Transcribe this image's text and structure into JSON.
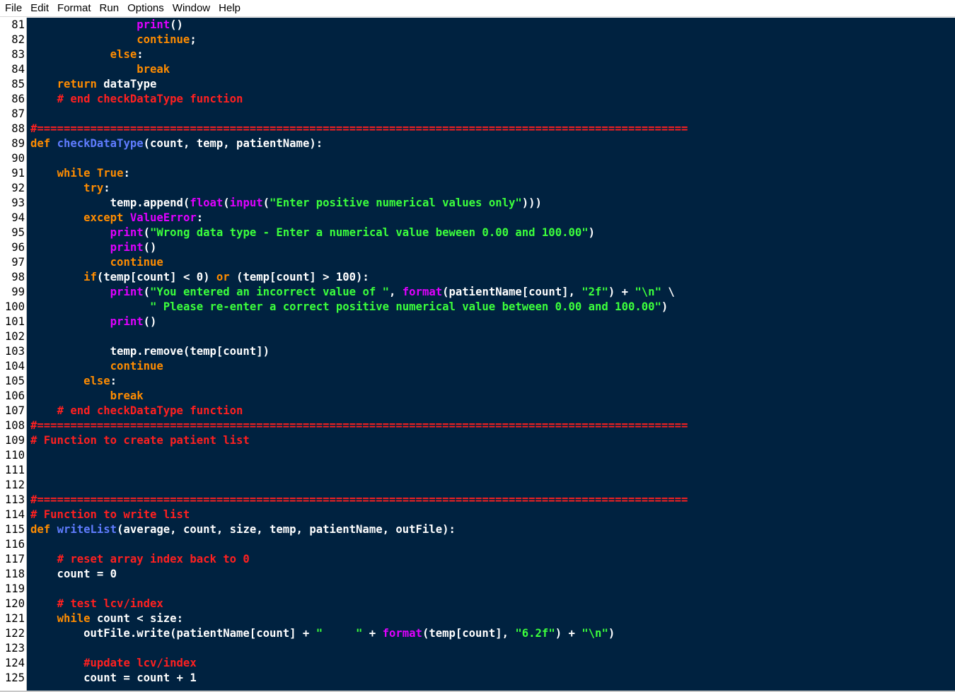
{
  "menu": [
    "File",
    "Edit",
    "Format",
    "Run",
    "Options",
    "Window",
    "Help"
  ],
  "colors": {
    "background": "#002240",
    "keyword": "#ff8c00",
    "definition": "#5f7cff",
    "builtin": "#e000ff",
    "string": "#3cff3c",
    "comment": "#ff2020",
    "default": "#ffffff"
  },
  "lines": [
    {
      "n": "81",
      "s": [
        [
          "",
          "                "
        ],
        [
          "bi",
          "print"
        ],
        [
          "",
          "()"
        ]
      ]
    },
    {
      "n": "82",
      "s": [
        [
          "",
          "                "
        ],
        [
          "kw",
          "continue"
        ],
        [
          "",
          ";"
        ]
      ]
    },
    {
      "n": "83",
      "s": [
        [
          "",
          "            "
        ],
        [
          "kw",
          "else"
        ],
        [
          "",
          ":"
        ]
      ]
    },
    {
      "n": "84",
      "s": [
        [
          "",
          "                "
        ],
        [
          "kw",
          "break"
        ]
      ]
    },
    {
      "n": "85",
      "s": [
        [
          "",
          "    "
        ],
        [
          "kw",
          "return"
        ],
        [
          "",
          " dataType"
        ]
      ]
    },
    {
      "n": "86",
      "s": [
        [
          "",
          "    "
        ],
        [
          "cmt",
          "# end checkDataType function"
        ]
      ]
    },
    {
      "n": "87",
      "s": []
    },
    {
      "n": "88",
      "s": [
        [
          "cmt",
          "#=================================================================================================="
        ]
      ]
    },
    {
      "n": "89",
      "s": [
        [
          "kw",
          "def"
        ],
        [
          "",
          " "
        ],
        [
          "def",
          "checkDataType"
        ],
        [
          "",
          "(count, temp, patientName):"
        ]
      ]
    },
    {
      "n": "90",
      "s": []
    },
    {
      "n": "91",
      "s": [
        [
          "",
          "    "
        ],
        [
          "kw",
          "while"
        ],
        [
          "",
          " "
        ],
        [
          "kw",
          "True"
        ],
        [
          "",
          ":"
        ]
      ]
    },
    {
      "n": "92",
      "s": [
        [
          "",
          "        "
        ],
        [
          "kw",
          "try"
        ],
        [
          "",
          ":"
        ]
      ]
    },
    {
      "n": "93",
      "s": [
        [
          "",
          "            temp.append("
        ],
        [
          "bi",
          "float"
        ],
        [
          "",
          "("
        ],
        [
          "bi",
          "input"
        ],
        [
          "",
          "("
        ],
        [
          "str",
          "\"Enter positive numerical values only\""
        ],
        [
          "",
          ")))"
        ]
      ]
    },
    {
      "n": "94",
      "s": [
        [
          "",
          "        "
        ],
        [
          "kw",
          "except"
        ],
        [
          "",
          " "
        ],
        [
          "bi",
          "ValueError"
        ],
        [
          "",
          ":"
        ]
      ]
    },
    {
      "n": "95",
      "s": [
        [
          "",
          "            "
        ],
        [
          "bi",
          "print"
        ],
        [
          "",
          "("
        ],
        [
          "str",
          "\"Wrong data type - Enter a numerical value beween 0.00 and 100.00\""
        ],
        [
          "",
          ")"
        ]
      ]
    },
    {
      "n": "96",
      "s": [
        [
          "",
          "            "
        ],
        [
          "bi",
          "print"
        ],
        [
          "",
          "()"
        ]
      ]
    },
    {
      "n": "97",
      "s": [
        [
          "",
          "            "
        ],
        [
          "kw",
          "continue"
        ]
      ]
    },
    {
      "n": "98",
      "s": [
        [
          "",
          "        "
        ],
        [
          "kw",
          "if"
        ],
        [
          "",
          "(temp[count] < 0) "
        ],
        [
          "kw",
          "or"
        ],
        [
          "",
          " (temp[count] > 100):"
        ]
      ]
    },
    {
      "n": "99",
      "s": [
        [
          "",
          "            "
        ],
        [
          "bi",
          "print"
        ],
        [
          "",
          "("
        ],
        [
          "str",
          "\"You entered an incorrect value of \""
        ],
        [
          "",
          ", "
        ],
        [
          "bi",
          "format"
        ],
        [
          "",
          "(patientName[count], "
        ],
        [
          "str",
          "\"2f\""
        ],
        [
          "",
          ") + "
        ],
        [
          "str",
          "\"\\n\""
        ],
        [
          "",
          " \\"
        ]
      ]
    },
    {
      "n": "100",
      "s": [
        [
          "",
          "                  "
        ],
        [
          "str",
          "\" Please re-enter a correct positive numerical value between 0.00 and 100.00\""
        ],
        [
          "",
          ")"
        ]
      ]
    },
    {
      "n": "101",
      "s": [
        [
          "",
          "            "
        ],
        [
          "bi",
          "print"
        ],
        [
          "",
          "()"
        ]
      ]
    },
    {
      "n": "102",
      "s": []
    },
    {
      "n": "103",
      "s": [
        [
          "",
          "            temp.remove(temp[count])"
        ]
      ]
    },
    {
      "n": "104",
      "s": [
        [
          "",
          "            "
        ],
        [
          "kw",
          "continue"
        ]
      ]
    },
    {
      "n": "105",
      "s": [
        [
          "",
          "        "
        ],
        [
          "kw",
          "else"
        ],
        [
          "",
          ":"
        ]
      ]
    },
    {
      "n": "106",
      "s": [
        [
          "",
          "            "
        ],
        [
          "kw",
          "break"
        ]
      ]
    },
    {
      "n": "107",
      "s": [
        [
          "",
          "    "
        ],
        [
          "cmt",
          "# end checkDataType function"
        ]
      ]
    },
    {
      "n": "108",
      "s": [
        [
          "cmt",
          "#=================================================================================================="
        ]
      ]
    },
    {
      "n": "109",
      "s": [
        [
          "cmt",
          "# Function to create patient list"
        ]
      ]
    },
    {
      "n": "110",
      "s": []
    },
    {
      "n": "111",
      "s": []
    },
    {
      "n": "112",
      "s": []
    },
    {
      "n": "113",
      "s": [
        [
          "cmt",
          "#=================================================================================================="
        ]
      ]
    },
    {
      "n": "114",
      "s": [
        [
          "cmt",
          "# Function to write list"
        ]
      ]
    },
    {
      "n": "115",
      "s": [
        [
          "kw",
          "def"
        ],
        [
          "",
          " "
        ],
        [
          "def",
          "writeList"
        ],
        [
          "",
          "(average, count, size, temp, patientName, outFile):"
        ]
      ]
    },
    {
      "n": "116",
      "s": []
    },
    {
      "n": "117",
      "s": [
        [
          "",
          "    "
        ],
        [
          "cmt",
          "# reset array index back to 0"
        ]
      ]
    },
    {
      "n": "118",
      "s": [
        [
          "",
          "    count = 0"
        ]
      ]
    },
    {
      "n": "119",
      "s": []
    },
    {
      "n": "120",
      "s": [
        [
          "",
          "    "
        ],
        [
          "cmt",
          "# test lcv/index"
        ]
      ]
    },
    {
      "n": "121",
      "s": [
        [
          "",
          "    "
        ],
        [
          "kw",
          "while"
        ],
        [
          "",
          " count < size:"
        ]
      ]
    },
    {
      "n": "122",
      "s": [
        [
          "",
          "        outFile.write(patientName[count] + "
        ],
        [
          "str",
          "\"     \""
        ],
        [
          "",
          " + "
        ],
        [
          "bi",
          "format"
        ],
        [
          "",
          "(temp[count], "
        ],
        [
          "str",
          "\"6.2f\""
        ],
        [
          "",
          ") + "
        ],
        [
          "str",
          "\"\\n\""
        ],
        [
          "",
          ")"
        ]
      ]
    },
    {
      "n": "123",
      "s": []
    },
    {
      "n": "124",
      "s": [
        [
          "",
          "        "
        ],
        [
          "cmt",
          "#update lcv/index"
        ]
      ]
    },
    {
      "n": "125",
      "s": [
        [
          "",
          "        count = count + 1"
        ]
      ]
    }
  ]
}
